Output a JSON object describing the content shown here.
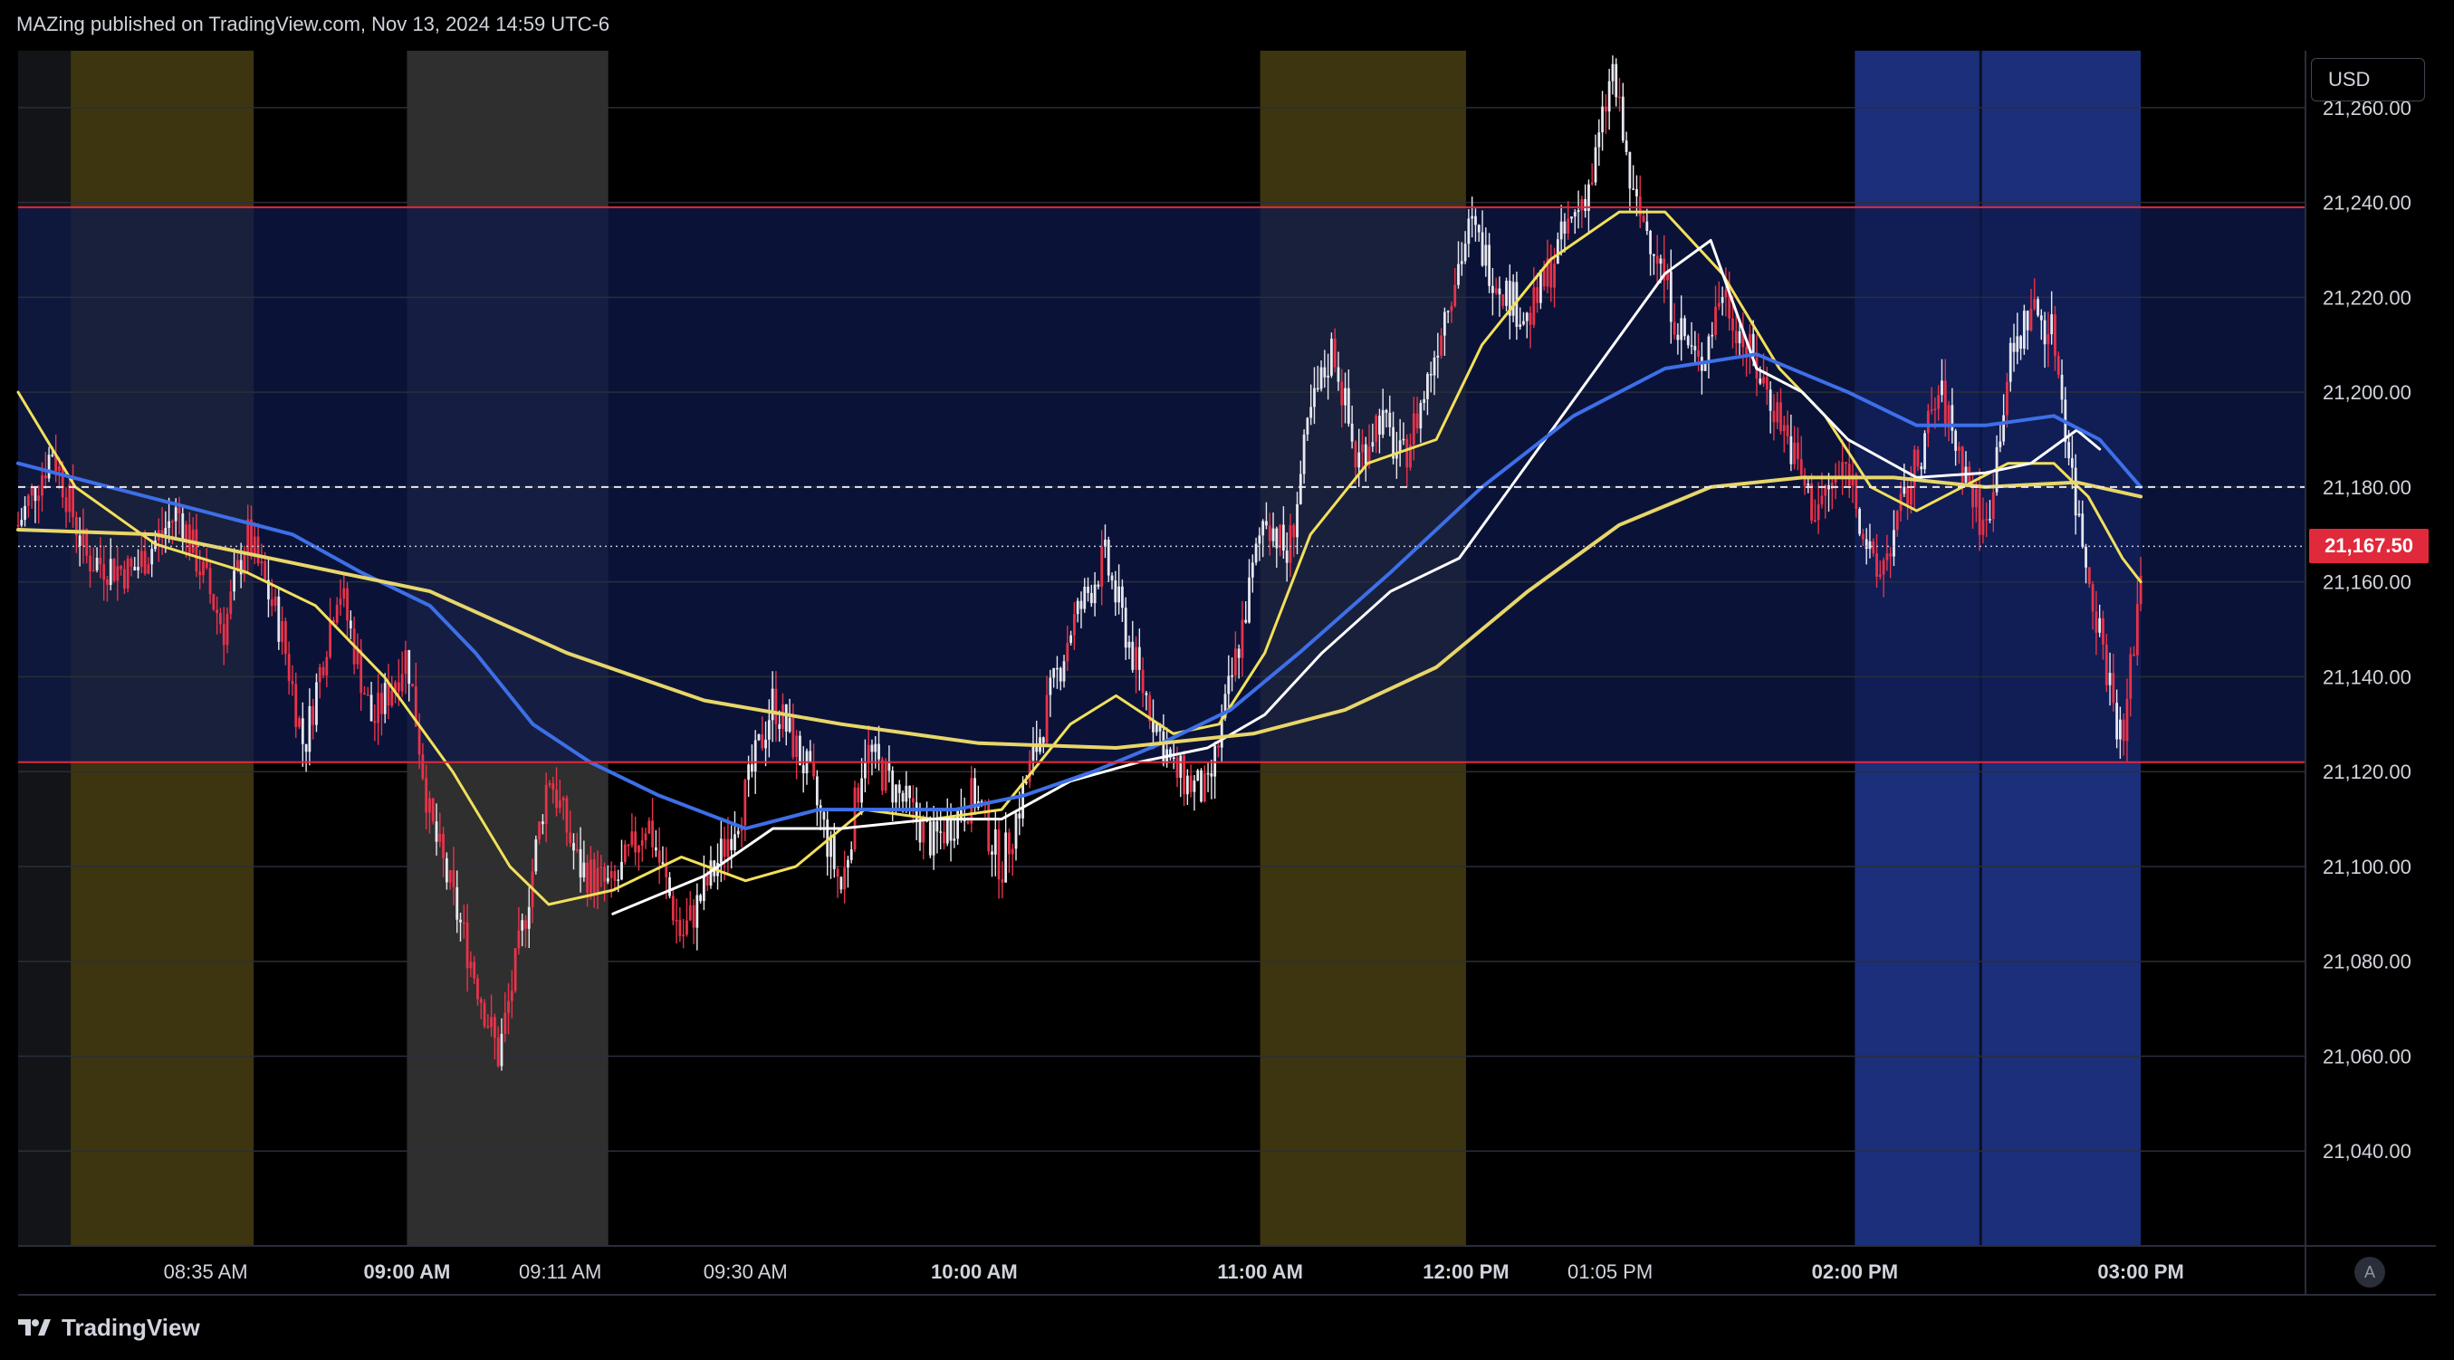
{
  "header": {
    "text": "MAZing published on TradingView.com, Nov 13, 2024 14:59 UTC-6"
  },
  "footer": {
    "brand": "TradingView",
    "logo_icon": "tradingview-logo-icon"
  },
  "price_axis": {
    "currency": "USD",
    "auto_label": "A"
  },
  "colors": {
    "up_candle": "#e8e8f0",
    "down_candle": "#e8334a",
    "ema_fast": "#f2e05a",
    "ema_mid": "#ffffff",
    "ema_slow": "#3d6fe8",
    "ema_long": "#e8d66a",
    "level_line": "#e0293a",
    "range_fill": "#0d1a4a",
    "session_yellow": "#3d3510",
    "session_gray": "#2f2f2f",
    "session_blue": "#1b2f7a"
  },
  "chart_data": {
    "type": "candlestick",
    "symbol_price_current": "21,167.50",
    "y_axis": {
      "range": [
        21020,
        21272
      ],
      "ticks": [
        "21,040.00",
        "21,060.00",
        "21,080.00",
        "21,100.00",
        "21,120.00",
        "21,140.00",
        "21,160.00",
        "21,180.00",
        "21,200.00",
        "21,220.00",
        "21,240.00",
        "21,260.00"
      ],
      "tick_values": [
        21040,
        21060,
        21080,
        21100,
        21120,
        21140,
        21160,
        21180,
        21200,
        21220,
        21240,
        21260
      ]
    },
    "x_axis": {
      "ticks": [
        {
          "label": "08:35 AM",
          "bold": false,
          "pos": 0.082
        },
        {
          "label": "09:00 AM",
          "bold": true,
          "pos": 0.17
        },
        {
          "label": "09:11 AM",
          "bold": false,
          "pos": 0.237
        },
        {
          "label": "09:30 AM",
          "bold": false,
          "pos": 0.318
        },
        {
          "label": "10:00 AM",
          "bold": true,
          "pos": 0.418
        },
        {
          "label": "11:00 AM",
          "bold": true,
          "pos": 0.543
        },
        {
          "label": "12:00 PM",
          "bold": true,
          "pos": 0.633
        },
        {
          "label": "01:05 PM",
          "bold": false,
          "pos": 0.696
        },
        {
          "label": "02:00 PM",
          "bold": true,
          "pos": 0.803
        },
        {
          "label": "03:00 PM",
          "bold": true,
          "pos": 0.928
        }
      ]
    },
    "levels": {
      "range_high": 21239,
      "range_low": 21122,
      "dashed_level": 21180,
      "current_dotted": 21167.5
    },
    "sessions": [
      {
        "kind": "yellow",
        "from": 0.023,
        "to": 0.103
      },
      {
        "kind": "gray",
        "from": 0.17,
        "to": 0.258
      },
      {
        "kind": "yellow",
        "from": 0.543,
        "to": 0.633
      },
      {
        "kind": "blue",
        "from": 0.803,
        "to": 0.928
      }
    ],
    "price_path": [
      [
        0.0,
        21172
      ],
      [
        0.015,
        21188
      ],
      [
        0.03,
        21165
      ],
      [
        0.05,
        21162
      ],
      [
        0.07,
        21175
      ],
      [
        0.09,
        21150
      ],
      [
        0.1,
        21170
      ],
      [
        0.115,
        21150
      ],
      [
        0.125,
        21125
      ],
      [
        0.14,
        21160
      ],
      [
        0.155,
        21130
      ],
      [
        0.17,
        21145
      ],
      [
        0.18,
        21110
      ],
      [
        0.195,
        21085
      ],
      [
        0.21,
        21060
      ],
      [
        0.22,
        21085
      ],
      [
        0.232,
        21120
      ],
      [
        0.245,
        21100
      ],
      [
        0.26,
        21095
      ],
      [
        0.275,
        21110
      ],
      [
        0.29,
        21085
      ],
      [
        0.305,
        21100
      ],
      [
        0.318,
        21115
      ],
      [
        0.33,
        21135
      ],
      [
        0.345,
        21120
      ],
      [
        0.36,
        21095
      ],
      [
        0.37,
        21125
      ],
      [
        0.385,
        21115
      ],
      [
        0.4,
        21105
      ],
      [
        0.418,
        21115
      ],
      [
        0.43,
        21100
      ],
      [
        0.445,
        21125
      ],
      [
        0.46,
        21150
      ],
      [
        0.475,
        21165
      ],
      [
        0.49,
        21140
      ],
      [
        0.505,
        21120
      ],
      [
        0.52,
        21115
      ],
      [
        0.535,
        21150
      ],
      [
        0.545,
        21175
      ],
      [
        0.555,
        21165
      ],
      [
        0.565,
        21195
      ],
      [
        0.575,
        21210
      ],
      [
        0.585,
        21185
      ],
      [
        0.595,
        21195
      ],
      [
        0.605,
        21185
      ],
      [
        0.615,
        21200
      ],
      [
        0.625,
        21220
      ],
      [
        0.635,
        21235
      ],
      [
        0.645,
        21225
      ],
      [
        0.66,
        21215
      ],
      [
        0.675,
        21232
      ],
      [
        0.688,
        21245
      ],
      [
        0.697,
        21268
      ],
      [
        0.706,
        21240
      ],
      [
        0.715,
        21232
      ],
      [
        0.725,
        21215
      ],
      [
        0.735,
        21205
      ],
      [
        0.745,
        21222
      ],
      [
        0.755,
        21210
      ],
      [
        0.77,
        21195
      ],
      [
        0.785,
        21175
      ],
      [
        0.8,
        21185
      ],
      [
        0.812,
        21160
      ],
      [
        0.82,
        21170
      ],
      [
        0.83,
        21185
      ],
      [
        0.84,
        21200
      ],
      [
        0.85,
        21185
      ],
      [
        0.86,
        21170
      ],
      [
        0.87,
        21205
      ],
      [
        0.88,
        21218
      ],
      [
        0.89,
        21212
      ],
      [
        0.9,
        21175
      ],
      [
        0.91,
        21150
      ],
      [
        0.92,
        21125
      ],
      [
        0.928,
        21162
      ]
    ],
    "ema_series": [
      {
        "key": "ema_fast",
        "width": 3,
        "values": [
          [
            0.0,
            21200
          ],
          [
            0.025,
            21180
          ],
          [
            0.06,
            21168
          ],
          [
            0.1,
            21162
          ],
          [
            0.13,
            21155
          ],
          [
            0.16,
            21140
          ],
          [
            0.19,
            21120
          ],
          [
            0.215,
            21100
          ],
          [
            0.232,
            21092
          ],
          [
            0.26,
            21095
          ],
          [
            0.29,
            21102
          ],
          [
            0.318,
            21097
          ],
          [
            0.34,
            21100
          ],
          [
            0.37,
            21112
          ],
          [
            0.4,
            21110
          ],
          [
            0.43,
            21112
          ],
          [
            0.46,
            21130
          ],
          [
            0.48,
            21136
          ],
          [
            0.505,
            21128
          ],
          [
            0.525,
            21130
          ],
          [
            0.545,
            21145
          ],
          [
            0.565,
            21170
          ],
          [
            0.59,
            21185
          ],
          [
            0.62,
            21190
          ],
          [
            0.64,
            21210
          ],
          [
            0.67,
            21228
          ],
          [
            0.7,
            21238
          ],
          [
            0.72,
            21238
          ],
          [
            0.745,
            21225
          ],
          [
            0.77,
            21205
          ],
          [
            0.79,
            21195
          ],
          [
            0.81,
            21180
          ],
          [
            0.83,
            21175
          ],
          [
            0.85,
            21180
          ],
          [
            0.87,
            21185
          ],
          [
            0.89,
            21185
          ],
          [
            0.905,
            21178
          ],
          [
            0.92,
            21165
          ],
          [
            0.928,
            21160
          ]
        ]
      },
      {
        "key": "ema_mid",
        "width": 3,
        "values": [
          [
            0.26,
            21090
          ],
          [
            0.3,
            21098
          ],
          [
            0.33,
            21108
          ],
          [
            0.36,
            21108
          ],
          [
            0.4,
            21110
          ],
          [
            0.43,
            21110
          ],
          [
            0.46,
            21118
          ],
          [
            0.49,
            21122
          ],
          [
            0.52,
            21125
          ],
          [
            0.545,
            21132
          ],
          [
            0.57,
            21145
          ],
          [
            0.6,
            21158
          ],
          [
            0.63,
            21165
          ],
          [
            0.66,
            21185
          ],
          [
            0.69,
            21205
          ],
          [
            0.72,
            21225
          ],
          [
            0.74,
            21232
          ],
          [
            0.76,
            21205
          ],
          [
            0.78,
            21200
          ],
          [
            0.8,
            21190
          ],
          [
            0.83,
            21182
          ],
          [
            0.86,
            21183
          ],
          [
            0.88,
            21185
          ],
          [
            0.9,
            21192
          ],
          [
            0.91,
            21188
          ]
        ]
      },
      {
        "key": "ema_slow",
        "width": 4,
        "values": [
          [
            0.0,
            21185
          ],
          [
            0.04,
            21180
          ],
          [
            0.08,
            21175
          ],
          [
            0.12,
            21170
          ],
          [
            0.15,
            21162
          ],
          [
            0.18,
            21155
          ],
          [
            0.2,
            21145
          ],
          [
            0.225,
            21130
          ],
          [
            0.25,
            21122
          ],
          [
            0.28,
            21115
          ],
          [
            0.318,
            21108
          ],
          [
            0.35,
            21112
          ],
          [
            0.38,
            21112
          ],
          [
            0.41,
            21112
          ],
          [
            0.44,
            21115
          ],
          [
            0.47,
            21120
          ],
          [
            0.5,
            21126
          ],
          [
            0.53,
            21133
          ],
          [
            0.56,
            21145
          ],
          [
            0.6,
            21162
          ],
          [
            0.64,
            21180
          ],
          [
            0.68,
            21195
          ],
          [
            0.72,
            21205
          ],
          [
            0.76,
            21208
          ],
          [
            0.8,
            21200
          ],
          [
            0.83,
            21193
          ],
          [
            0.86,
            21193
          ],
          [
            0.89,
            21195
          ],
          [
            0.91,
            21190
          ],
          [
            0.928,
            21180
          ]
        ]
      },
      {
        "key": "ema_long",
        "width": 4,
        "values": [
          [
            0.0,
            21171
          ],
          [
            0.06,
            21170
          ],
          [
            0.12,
            21164
          ],
          [
            0.18,
            21158
          ],
          [
            0.24,
            21145
          ],
          [
            0.3,
            21135
          ],
          [
            0.36,
            21130
          ],
          [
            0.42,
            21126
          ],
          [
            0.48,
            21125
          ],
          [
            0.54,
            21128
          ],
          [
            0.58,
            21133
          ],
          [
            0.62,
            21142
          ],
          [
            0.66,
            21158
          ],
          [
            0.7,
            21172
          ],
          [
            0.74,
            21180
          ],
          [
            0.78,
            21182
          ],
          [
            0.82,
            21182
          ],
          [
            0.86,
            21180
          ],
          [
            0.9,
            21181
          ],
          [
            0.928,
            21178
          ]
        ]
      }
    ]
  }
}
